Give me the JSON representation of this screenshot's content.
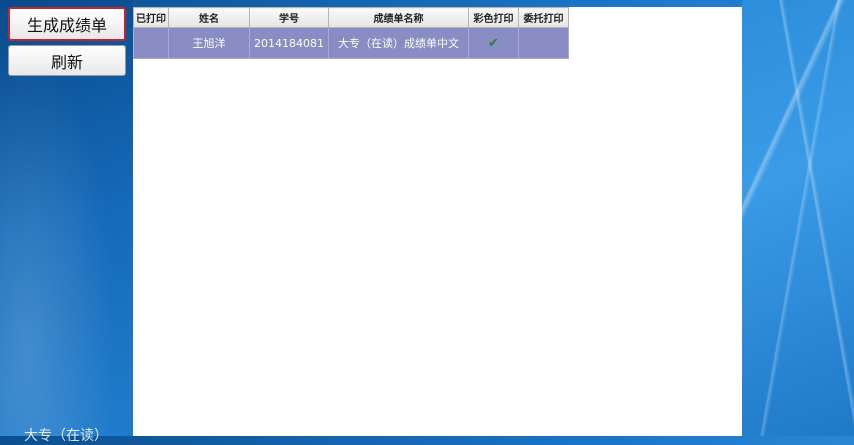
{
  "toolbar": {
    "generate_label": "生成成绩单",
    "refresh_label": "刷新"
  },
  "table": {
    "headers": [
      "已打印",
      "姓名",
      "学号",
      "成绩单名称",
      "彩色打印",
      "委托打印"
    ],
    "rows": [
      [
        "",
        "王旭洋",
        "2014184081",
        "大专（在读）成绩单中文",
        "✔",
        ""
      ]
    ]
  },
  "footer_text": "大专（在读）"
}
